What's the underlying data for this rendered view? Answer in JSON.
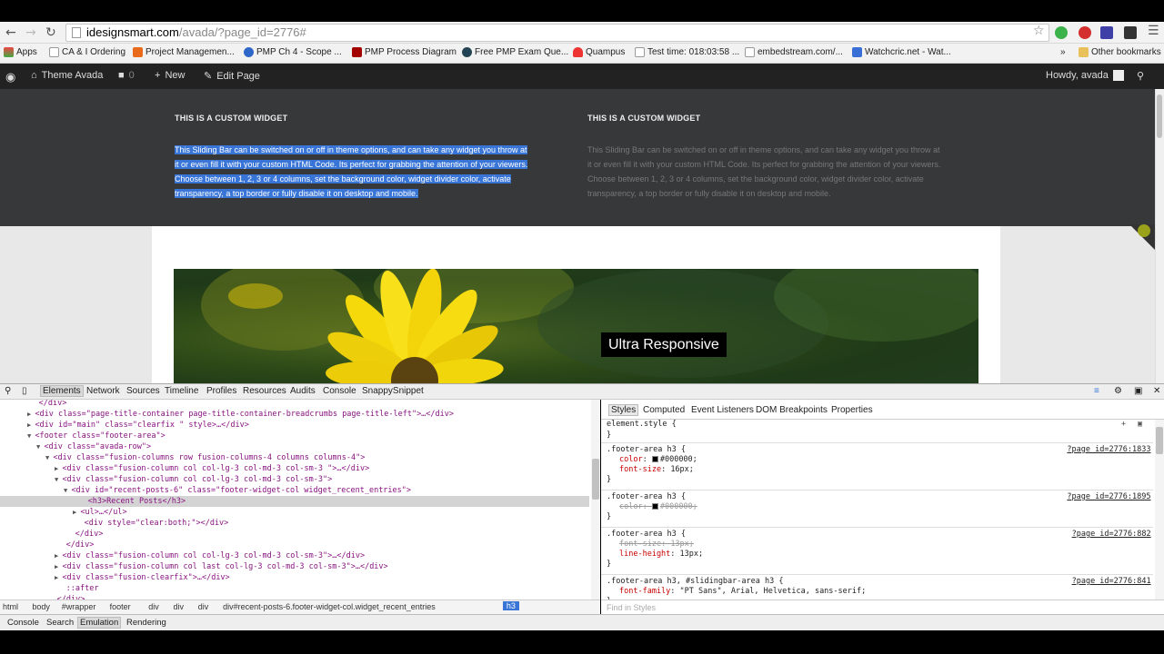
{
  "browser": {
    "url_domain": "idesignsmart.com",
    "url_path": "/avada/?page_id=2776#",
    "bookmarks": [
      "Apps",
      "CA & I Ordering",
      "Project Managemen...",
      "PMP Ch 4 - Scope ...",
      "PMP Process Diagram",
      "Free PMP Exam Que...",
      "Quampus",
      "Test time: 018:03:58 ...",
      "embedstream.com/...",
      "Watchcric.net - Wat...",
      "Other bookmarks"
    ],
    "bookmark_overflow": "»"
  },
  "wp_admin_bar": {
    "site_name": "Theme Avada",
    "comments_count": "0",
    "new_label": "New",
    "edit_label": "Edit Page",
    "howdy": "Howdy, avada"
  },
  "sliding_bar": {
    "left_title": "THIS IS A CUSTOM WIDGET",
    "right_title": "THIS IS A CUSTOM WIDGET",
    "lines": [
      "This Sliding Bar can be switched on or off in theme options, and can take any widget you throw at",
      "it or even fill it with your custom HTML Code. Its perfect for grabbing the attention of your viewers.",
      "Choose between 1, 2, 3 or 4 columns, set the background color, widget divider color, activate",
      "transparency, a top border or fully disable it on desktop and mobile."
    ]
  },
  "hero": {
    "caption": "Ultra Responsive"
  },
  "devtools": {
    "tabs": [
      "Elements",
      "Network",
      "Sources",
      "Timeline",
      "Profiles",
      "Resources",
      "Audits",
      "Console",
      "SnappySnippet"
    ],
    "active_tab": "Elements",
    "dom_lines": [
      {
        "indent": 0,
        "text": "</div>",
        "kind": "close"
      },
      {
        "indent": 0,
        "text": "<div class=\"page-title-container page-title-container-breadcrumbs page-title-left\">…</div>",
        "kind": "collapsed"
      },
      {
        "indent": 0,
        "text": "<div id=\"main\" class=\"clearfix \" style>…</div>",
        "kind": "collapsed"
      },
      {
        "indent": 0,
        "text": "<footer class=\"footer-area\">",
        "kind": "open"
      },
      {
        "indent": 1,
        "text": "<div class=\"avada-row\">",
        "kind": "open"
      },
      {
        "indent": 2,
        "text": "<div class=\"fusion-columns row fusion-columns-4 columns columns-4\">",
        "kind": "open"
      },
      {
        "indent": 3,
        "text": "<div class=\"fusion-column col col-lg-3 col-md-3 col-sm-3 \">…</div>",
        "kind": "collapsed"
      },
      {
        "indent": 3,
        "text": "<div class=\"fusion-column col col-lg-3 col-md-3 col-sm-3\">",
        "kind": "open"
      },
      {
        "indent": 4,
        "text": "<div id=\"recent-posts-6\" class=\"footer-widget-col widget_recent_entries\">",
        "kind": "open"
      },
      {
        "indent": 5,
        "text": "<h3>Recent Posts</h3>",
        "kind": "selected"
      },
      {
        "indent": 5,
        "text": "<ul>…</ul>",
        "kind": "collapsed"
      },
      {
        "indent": 5,
        "text": "<div style=\"clear:both;\"></div>",
        "kind": "leaf"
      },
      {
        "indent": 4,
        "text": "</div>",
        "kind": "close"
      },
      {
        "indent": 3,
        "text": "</div>",
        "kind": "close"
      },
      {
        "indent": 3,
        "text": "<div class=\"fusion-column col col-lg-3 col-md-3 col-sm-3\">…</div>",
        "kind": "collapsed"
      },
      {
        "indent": 3,
        "text": "<div class=\"fusion-column col last col-lg-3 col-md-3 col-sm-3\">…</div>",
        "kind": "collapsed"
      },
      {
        "indent": 3,
        "text": "<div class=\"fusion-clearfix\">…</div>",
        "kind": "collapsed"
      },
      {
        "indent": 3,
        "text": "::after",
        "kind": "pseudo"
      },
      {
        "indent": 2,
        "text": "</div>",
        "kind": "close"
      }
    ],
    "styles_tabs": [
      "Styles",
      "Computed",
      "Event Listeners",
      "DOM Breakpoints",
      "Properties"
    ],
    "element_style": "element.style {",
    "element_style_close": "}",
    "rules": [
      {
        "selector": ".footer-area h3 {",
        "source": "?page_id=2776:1833",
        "props": [
          {
            "name": "color",
            "value": "#000000;",
            "swatch": "#000000",
            "struck": false
          },
          {
            "name": "font-size",
            "value": "16px;",
            "struck": false
          }
        ]
      },
      {
        "selector": ".footer-area h3 {",
        "source": "?page_id=2776:1895",
        "props": [
          {
            "name": "color",
            "value": "#000000;",
            "swatch": "#000000",
            "struck": true
          }
        ]
      },
      {
        "selector": ".footer-area h3 {",
        "source": "?page_id=2776:882",
        "props": [
          {
            "name": "font-size",
            "value": "13px;",
            "struck": true
          },
          {
            "name": "line-height",
            "value": "13px;",
            "struck": false
          }
        ]
      },
      {
        "selector": ".footer-area h3, #slidingbar-area h3 {",
        "source": "?page_id=2776:841",
        "props": [
          {
            "name": "font-family",
            "value": "\"PT Sans\", Arial, Helvetica, sans-serif;",
            "struck": false
          }
        ]
      }
    ],
    "breadcrumbs": [
      "html",
      "body",
      "#wrapper",
      "footer",
      "div",
      "div",
      "div",
      "div#recent-posts-6.footer-widget-col.widget_recent_entries",
      "h3"
    ],
    "find_placeholder": "Find in Styles",
    "drawer_tabs": [
      "Console",
      "Search",
      "Emulation",
      "Rendering"
    ],
    "drawer_active": "Emulation"
  }
}
